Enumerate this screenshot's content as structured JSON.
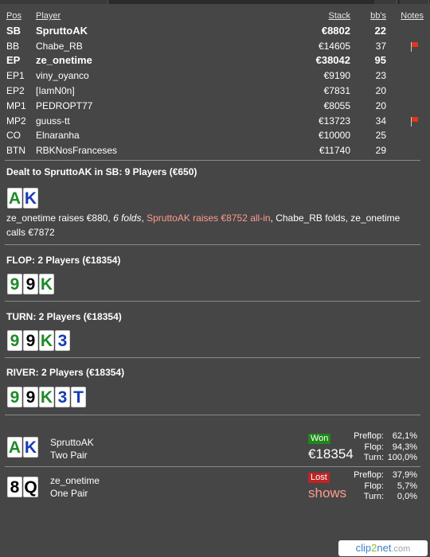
{
  "table_header": {
    "pos": "Pos",
    "player": "Player",
    "stack": "Stack",
    "bbs": "bb's",
    "notes": "Notes"
  },
  "players": [
    {
      "pos": "SB",
      "name": "SpruttoAK",
      "stack": "€8802",
      "bbs": "22",
      "bold": true,
      "flag": false
    },
    {
      "pos": "BB",
      "name": "Chabe_RB",
      "stack": "€14605",
      "bbs": "37",
      "bold": false,
      "flag": true
    },
    {
      "pos": "EP",
      "name": "ze_onetime",
      "stack": "€38042",
      "bbs": "95",
      "bold": true,
      "flag": false
    },
    {
      "pos": "EP1",
      "name": "viny_oyanco",
      "stack": "€9190",
      "bbs": "23",
      "bold": false,
      "flag": false
    },
    {
      "pos": "EP2",
      "name": "[IamN0n]",
      "stack": "€7831",
      "bbs": "20",
      "bold": false,
      "flag": false
    },
    {
      "pos": "MP1",
      "name": "PEDROPT77",
      "stack": "€8055",
      "bbs": "20",
      "bold": false,
      "flag": false
    },
    {
      "pos": "MP2",
      "name": "guuss-tt",
      "stack": "€13723",
      "bbs": "34",
      "bold": false,
      "flag": true
    },
    {
      "pos": "CO",
      "name": "Elnaranha",
      "stack": "€10000",
      "bbs": "25",
      "bold": false,
      "flag": false
    },
    {
      "pos": "BTN",
      "name": "RBKNosFranceses",
      "stack": "€11740",
      "bbs": "29",
      "bold": false,
      "flag": false
    }
  ],
  "flag_icon": "red-flag-icon",
  "preflop": {
    "title": "Dealt to SpruttoAK in SB: 9 Players (€650)",
    "cards": [
      {
        "rank": "A",
        "color": "green"
      },
      {
        "rank": "K",
        "color": "blue"
      }
    ],
    "action_1": "ze_onetime raises €880, ",
    "action_2": "6 folds",
    "action_3": ", ",
    "action_4": "SpruttoAK raises €8752 all-in",
    "action_5": ", Chabe_RB folds, ze_onetime calls €7872"
  },
  "streets": [
    {
      "title": "FLOP: 2 Players (€18354)",
      "cards": [
        {
          "rank": "9",
          "color": "green"
        },
        {
          "rank": "9",
          "color": "black"
        },
        {
          "rank": "K",
          "color": "green"
        }
      ]
    },
    {
      "title": "TURN: 2 Players (€18354)",
      "cards": [
        {
          "rank": "9",
          "color": "green"
        },
        {
          "rank": "9",
          "color": "black"
        },
        {
          "rank": "K",
          "color": "green"
        },
        {
          "rank": "3",
          "color": "blue"
        }
      ]
    },
    {
      "title": "RIVER: 2 Players (€18354)",
      "cards": [
        {
          "rank": "9",
          "color": "green"
        },
        {
          "rank": "9",
          "color": "black"
        },
        {
          "rank": "K",
          "color": "green"
        },
        {
          "rank": "3",
          "color": "blue"
        },
        {
          "rank": "T",
          "color": "blue"
        }
      ]
    }
  ],
  "results": [
    {
      "name": "SpruttoAK",
      "hand": "Two Pair",
      "badge": "Won",
      "amount": "€18354",
      "cards": [
        {
          "rank": "A",
          "color": "green"
        },
        {
          "rank": "K",
          "color": "blue"
        }
      ],
      "equity": [
        {
          "label": "Preflop:",
          "value": "62,1%"
        },
        {
          "label": "Flop:",
          "value": "94,3%"
        },
        {
          "label": "Turn:",
          "value": "100,0%"
        }
      ]
    },
    {
      "name": "ze_onetime",
      "hand": "One Pair",
      "badge": "Lost",
      "amount": "shows",
      "cards": [
        {
          "rank": "8",
          "color": "black"
        },
        {
          "rank": "Q",
          "color": "black"
        }
      ],
      "equity": [
        {
          "label": "Preflop:",
          "value": "37,9%"
        },
        {
          "label": "Flop:",
          "value": "5,7%"
        },
        {
          "label": "Turn:",
          "value": "0,0%"
        }
      ]
    }
  ],
  "logo": {
    "part1": "clip",
    "part2": "2",
    "part3": "net",
    ".com": ".com"
  },
  "colors": {
    "background": "#464646",
    "won": "#21861b",
    "lost": "#c02323",
    "highlight": "#ff9b8f",
    "card_green": "#1e8a27",
    "card_blue": "#173bb5"
  }
}
